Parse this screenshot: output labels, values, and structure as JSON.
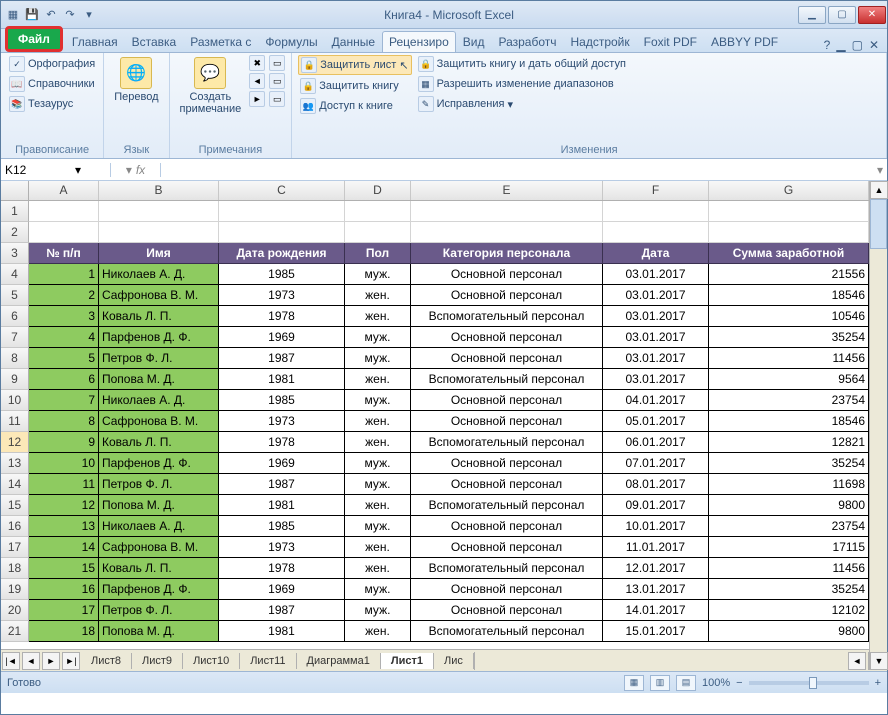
{
  "title": "Книга4  -  Microsoft Excel",
  "qat_icons": [
    "xl",
    "save",
    "undo",
    "redo",
    "more"
  ],
  "win": {
    "min": "▁",
    "max": "▢",
    "close": "✕"
  },
  "tabs": {
    "file": "Файл",
    "items": [
      "Главная",
      "Вставка",
      "Разметка с",
      "Формулы",
      "Данные",
      "Рецензиро",
      "Вид",
      "Разработч",
      "Надстройк",
      "Foxit PDF",
      "ABBYY PDF"
    ],
    "active": 5,
    "help": "?"
  },
  "ribbon": {
    "proofing": {
      "label": "Правописание",
      "spelling": "Орфография",
      "research": "Справочники",
      "thesaurus": "Тезаурус"
    },
    "language": {
      "label": "Язык",
      "translate": "Перевод"
    },
    "comments": {
      "label": "Примечания",
      "new": "Создать\nпримечание"
    },
    "changes": {
      "label": "Изменения",
      "protect_sheet": "Защитить лист",
      "protect_wb": "Защитить книгу",
      "share_wb": "Доступ к книге",
      "protect_share": "Защитить книгу и дать общий доступ",
      "allow_ranges": "Разрешить изменение диапазонов",
      "track": "Исправления"
    }
  },
  "namebox": "K12",
  "fx": "fx",
  "cols": [
    "A",
    "B",
    "C",
    "D",
    "E",
    "F",
    "G"
  ],
  "header_row_num": "3",
  "headers": [
    "№ п/п",
    "Имя",
    "Дата рождения",
    "Пол",
    "Категория персонала",
    "Дата",
    "Сумма заработной"
  ],
  "chart_data": {
    "type": "table",
    "columns": [
      "№ п/п",
      "Имя",
      "Дата рождения",
      "Пол",
      "Категория персонала",
      "Дата",
      "Сумма заработной"
    ],
    "rows": [
      [
        1,
        "Николаев А. Д.",
        1985,
        "муж.",
        "Основной персонал",
        "03.01.2017",
        21556
      ],
      [
        2,
        "Сафронова В. М.",
        1973,
        "жен.",
        "Основной персонал",
        "03.01.2017",
        18546
      ],
      [
        3,
        "Коваль Л. П.",
        1978,
        "жен.",
        "Вспомогательный персонал",
        "03.01.2017",
        10546
      ],
      [
        4,
        "Парфенов Д. Ф.",
        1969,
        "муж.",
        "Основной персонал",
        "03.01.2017",
        35254
      ],
      [
        5,
        "Петров Ф. Л.",
        1987,
        "муж.",
        "Основной персонал",
        "03.01.2017",
        11456
      ],
      [
        6,
        "Попова М. Д.",
        1981,
        "жен.",
        "Вспомогательный персонал",
        "03.01.2017",
        9564
      ],
      [
        7,
        "Николаев А. Д.",
        1985,
        "муж.",
        "Основной персонал",
        "04.01.2017",
        23754
      ],
      [
        8,
        "Сафронова В. М.",
        1973,
        "жен.",
        "Основной персонал",
        "05.01.2017",
        18546
      ],
      [
        9,
        "Коваль Л. П.",
        1978,
        "жен.",
        "Вспомогательный персонал",
        "06.01.2017",
        12821
      ],
      [
        10,
        "Парфенов Д. Ф.",
        1969,
        "муж.",
        "Основной персонал",
        "07.01.2017",
        35254
      ],
      [
        11,
        "Петров Ф. Л.",
        1987,
        "муж.",
        "Основной персонал",
        "08.01.2017",
        11698
      ],
      [
        12,
        "Попова М. Д.",
        1981,
        "жен.",
        "Вспомогательный персонал",
        "09.01.2017",
        9800
      ],
      [
        13,
        "Николаев А. Д.",
        1985,
        "муж.",
        "Основной персонал",
        "10.01.2017",
        23754
      ],
      [
        14,
        "Сафронова В. М.",
        1973,
        "жен.",
        "Основной персонал",
        "11.01.2017",
        17115
      ],
      [
        15,
        "Коваль Л. П.",
        1978,
        "жен.",
        "Вспомогательный персонал",
        "12.01.2017",
        11456
      ],
      [
        16,
        "Парфенов Д. Ф.",
        1969,
        "муж.",
        "Основной персонал",
        "13.01.2017",
        35254
      ],
      [
        17,
        "Петров Ф. Л.",
        1987,
        "муж.",
        "Основной персонал",
        "14.01.2017",
        12102
      ],
      [
        18,
        "Попова М. Д.",
        1981,
        "жен.",
        "Вспомогательный персонал",
        "15.01.2017",
        9800
      ]
    ]
  },
  "row_start": 4,
  "selected_excel_row": 12,
  "sheets": {
    "items": [
      "Лист8",
      "Лист9",
      "Лист10",
      "Лист11",
      "Диаграмма1",
      "Лист1",
      "Лис"
    ],
    "active": 5
  },
  "status": {
    "ready": "Готово",
    "zoom": "100%",
    "minus": "−",
    "plus": "+"
  }
}
